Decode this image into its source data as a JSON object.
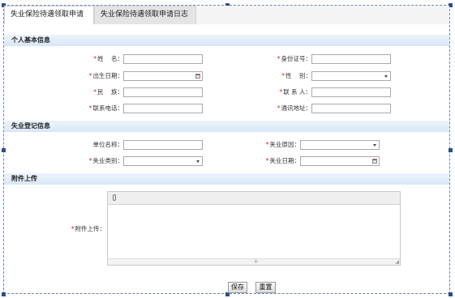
{
  "tabs": [
    {
      "label": "失业保险待遇领取申请",
      "active": true
    },
    {
      "label": "失业保险待遇领取申请日志",
      "active": false
    }
  ],
  "sections": {
    "personal": "个人基本信息",
    "unemployment": "失业登记信息",
    "attachment": "附件上传"
  },
  "personal": {
    "name_label": "姓    名：",
    "id_label": "身份证号：",
    "birth_label": "出生日期：",
    "gender_label": "性    别：",
    "ethnicity_label": "民    族：",
    "contact_label": "联 系 人：",
    "phone_label": "联系电话：",
    "address_label": "通讯地址："
  },
  "unemployment": {
    "employer_label": "单位名称：",
    "reason_label": "失业原因：",
    "type_label": "失业类别：",
    "date_label": "失业日期："
  },
  "attachment": {
    "upload_label": "附件上传："
  },
  "buttons": {
    "save": "保存",
    "reset": "重置"
  },
  "required_mark": "*",
  "icons": {
    "move": "✣",
    "resize": "◢"
  }
}
